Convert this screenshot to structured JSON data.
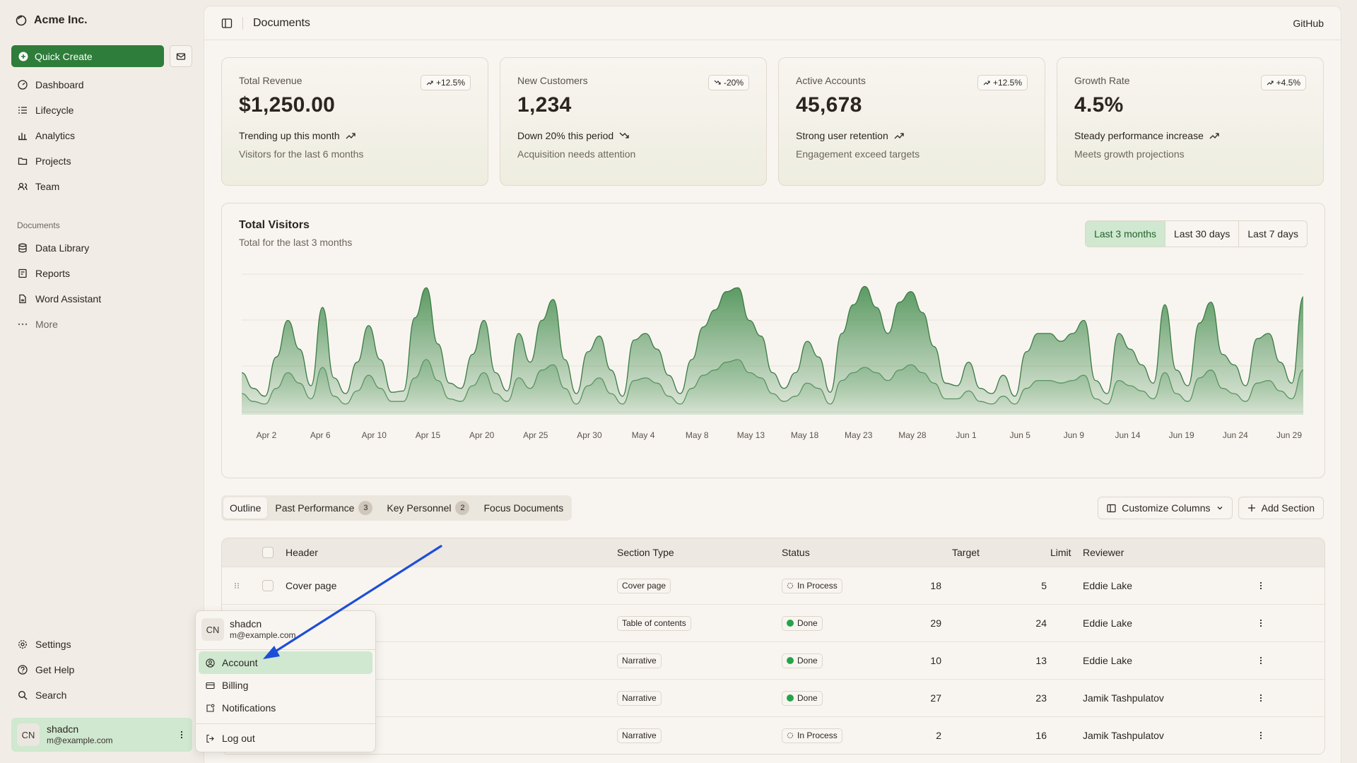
{
  "brand": {
    "name": "Acme Inc."
  },
  "sidebar": {
    "quick_create": "Quick Create",
    "main_items": [
      {
        "label": "Dashboard",
        "icon": "dashboard-icon"
      },
      {
        "label": "Lifecycle",
        "icon": "list-icon"
      },
      {
        "label": "Analytics",
        "icon": "bar-chart-icon"
      },
      {
        "label": "Projects",
        "icon": "folder-icon"
      },
      {
        "label": "Team",
        "icon": "users-icon"
      }
    ],
    "documents_label": "Documents",
    "doc_items": [
      {
        "label": "Data Library",
        "icon": "database-icon"
      },
      {
        "label": "Reports",
        "icon": "report-icon"
      },
      {
        "label": "Word Assistant",
        "icon": "file-icon"
      },
      {
        "label": "More",
        "icon": "dots-icon"
      }
    ],
    "bottom_items": [
      {
        "label": "Settings",
        "icon": "gear-icon"
      },
      {
        "label": "Get Help",
        "icon": "help-icon"
      },
      {
        "label": "Search",
        "icon": "search-icon"
      }
    ],
    "user": {
      "initials": "CN",
      "name": "shadcn",
      "email": "m@example.com"
    }
  },
  "topbar": {
    "title": "Documents",
    "github": "GitHub"
  },
  "cards": [
    {
      "label": "Total Revenue",
      "value": "$1,250.00",
      "badge": "+12.5%",
      "trend": "Trending up this month",
      "sub": "Visitors for the last 6 months"
    },
    {
      "label": "New Customers",
      "value": "1,234",
      "badge": "-20%",
      "trend": "Down 20% this period",
      "sub": "Acquisition needs attention"
    },
    {
      "label": "Active Accounts",
      "value": "45,678",
      "badge": "+12.5%",
      "trend": "Strong user retention",
      "sub": "Engagement exceed targets"
    },
    {
      "label": "Growth Rate",
      "value": "4.5%",
      "badge": "+4.5%",
      "trend": "Steady performance increase",
      "sub": "Meets growth projections"
    }
  ],
  "chart": {
    "title": "Total Visitors",
    "subtitle": "Total for the last 3 months",
    "ranges": [
      "Last 3 months",
      "Last 30 days",
      "Last 7 days"
    ],
    "active_range": "Last 3 months"
  },
  "chart_data": {
    "type": "area",
    "title": "Total Visitors",
    "subtitle": "Total for the last 3 months",
    "tick_labels": [
      "Apr 2",
      "Apr 6",
      "Apr 10",
      "Apr 15",
      "Apr 20",
      "Apr 25",
      "Apr 30",
      "May 4",
      "May 8",
      "May 13",
      "May 18",
      "May 23",
      "May 28",
      "Jun 1",
      "Jun 5",
      "Jun 9",
      "Jun 14",
      "Jun 19",
      "Jun 24",
      "Jun 29"
    ],
    "ylim": [
      0,
      100
    ],
    "grid": true,
    "series": [
      {
        "values": [
          30,
          18,
          12,
          42,
          70,
          48,
          20,
          80,
          26,
          14,
          38,
          66,
          40,
          15,
          16,
          72,
          95,
          52,
          22,
          18,
          44,
          70,
          30,
          16,
          60,
          38,
          70,
          86,
          40,
          14,
          46,
          58,
          32,
          12,
          55,
          60,
          48,
          28,
          14,
          40,
          65,
          78,
          92,
          95,
          70,
          58,
          30,
          18,
          30,
          54,
          42,
          15,
          60,
          82,
          96,
          80,
          60,
          84,
          92,
          76,
          50,
          22,
          20,
          38,
          18,
          14,
          28,
          12,
          46,
          60,
          60,
          54,
          60,
          70,
          24,
          14,
          60,
          48,
          36,
          22,
          82,
          32,
          20,
          68,
          84,
          44,
          36,
          20,
          56,
          60,
          38,
          22,
          88
        ]
      },
      {
        "values": [
          14,
          8,
          6,
          18,
          30,
          22,
          10,
          34,
          12,
          6,
          16,
          28,
          18,
          8,
          8,
          26,
          40,
          24,
          10,
          8,
          20,
          30,
          14,
          8,
          26,
          18,
          32,
          36,
          18,
          6,
          20,
          26,
          14,
          6,
          24,
          26,
          22,
          12,
          6,
          18,
          28,
          32,
          38,
          40,
          30,
          26,
          14,
          8,
          12,
          22,
          18,
          6,
          24,
          30,
          34,
          30,
          24,
          32,
          36,
          30,
          22,
          10,
          10,
          16,
          8,
          6,
          12,
          6,
          18,
          24,
          24,
          22,
          24,
          28,
          10,
          6,
          24,
          20,
          16,
          10,
          30,
          14,
          8,
          26,
          32,
          18,
          14,
          8,
          22,
          24,
          16,
          10,
          32
        ]
      }
    ]
  },
  "tabs": [
    {
      "label": "Outline",
      "count": ""
    },
    {
      "label": "Past Performance",
      "count": "3"
    },
    {
      "label": "Key Personnel",
      "count": "2"
    },
    {
      "label": "Focus Documents",
      "count": ""
    }
  ],
  "actions": {
    "customize": "Customize Columns",
    "add": "Add Section"
  },
  "table": {
    "headers": {
      "header": "Header",
      "type": "Section Type",
      "status": "Status",
      "target": "Target",
      "limit": "Limit",
      "reviewer": "Reviewer"
    },
    "rows": [
      {
        "header": "Cover page",
        "type": "Cover page",
        "status": "In Process",
        "target": "18",
        "limit": "5",
        "reviewer": "Eddie Lake"
      },
      {
        "header": "",
        "type": "Table of contents",
        "status": "Done",
        "target": "29",
        "limit": "24",
        "reviewer": "Eddie Lake"
      },
      {
        "header": "",
        "type": "Narrative",
        "status": "Done",
        "target": "10",
        "limit": "13",
        "reviewer": "Eddie Lake"
      },
      {
        "header": "",
        "type": "Narrative",
        "status": "Done",
        "target": "27",
        "limit": "23",
        "reviewer": "Jamik Tashpulatov"
      },
      {
        "header": "",
        "type": "Narrative",
        "status": "In Process",
        "target": "2",
        "limit": "16",
        "reviewer": "Jamik Tashpulatov"
      }
    ]
  },
  "menu": {
    "initials": "CN",
    "name": "shadcn",
    "email": "m@example.com",
    "items": [
      "Account",
      "Billing",
      "Notifications"
    ],
    "logout": "Log out"
  },
  "colors": {
    "accent": "#2e7d3a",
    "accent_soft": "#cfe8cf",
    "arrow": "#1d4ed8"
  }
}
